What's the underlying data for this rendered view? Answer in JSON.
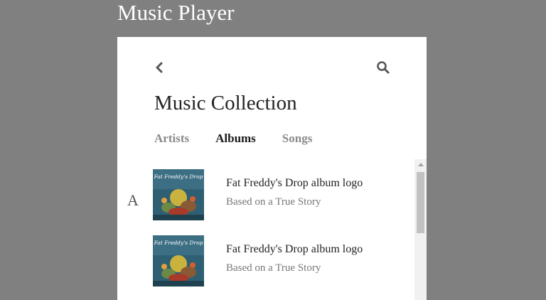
{
  "page": {
    "title": "Music Player"
  },
  "header": {
    "back_icon": "chevron-left-icon",
    "search_icon": "search-icon",
    "title": "Music Collection"
  },
  "tabs": [
    {
      "label": "Artists",
      "active": false
    },
    {
      "label": "Albums",
      "active": true
    },
    {
      "label": "Songs",
      "active": false
    }
  ],
  "list": {
    "section_letter": "A",
    "albums": [
      {
        "title": "Fat Freddy's Drop album logo",
        "subtitle": "Based on a True Story",
        "cover_text": "Fat Freddy's Drop"
      },
      {
        "title": "Fat Freddy's Drop album logo",
        "subtitle": "Based on a True Story",
        "cover_text": "Fat Freddy's Drop"
      }
    ]
  },
  "colors": {
    "background": "#808080",
    "panel": "#ffffff",
    "active_tab": "#1a1a1a",
    "inactive_tab": "#8a8a8a"
  }
}
